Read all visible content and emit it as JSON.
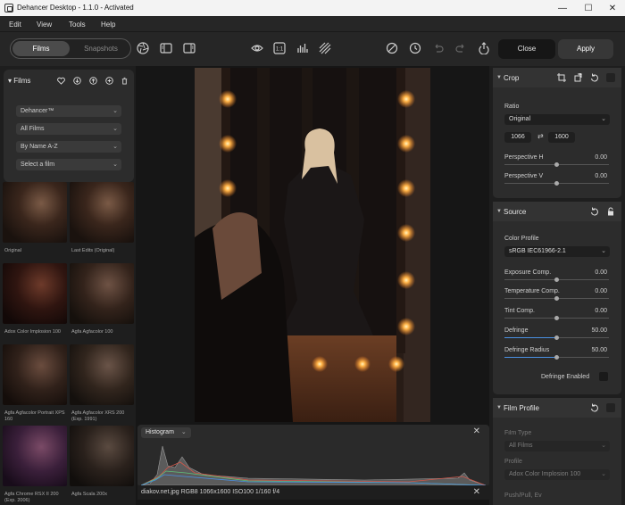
{
  "window": {
    "title": "Dehancer Desktop - 1.1.0 - Activated"
  },
  "menu": [
    "Edit",
    "View",
    "Tools",
    "Help"
  ],
  "toolbar": {
    "tab_films": "Films",
    "tab_snapshots": "Snapshots",
    "close_label": "Close",
    "apply_label": "Apply"
  },
  "films_panel": {
    "title": "Films",
    "selects": [
      "Dehancer™",
      "All Films",
      "By Name A-Z",
      "Select a film"
    ],
    "thumbnails": [
      "Original",
      "Last Edits (Original)",
      "Adox Color Implosion 100",
      "Agfa Agfacolor 100",
      "Agfa Agfacolor Portrait XPS 160",
      "Agfa Agfacolor XRS 200 (Exp. 1991)",
      "Agfa Chrome RSX II 200 (Exp. 2006)",
      "Agfa Scala 200x"
    ]
  },
  "histogram": {
    "title": "Histogram"
  },
  "info_bar": {
    "text": "diakov.net.jpg  RGB8  1066x1600  ISO100  1/160  f/4"
  },
  "crop": {
    "title": "Crop",
    "ratio_label": "Ratio",
    "ratio_value": "Original",
    "width": "1066",
    "height": "1600",
    "perspective_h_label": "Perspective H",
    "perspective_h_value": "0.00",
    "perspective_v_label": "Perspective V",
    "perspective_v_value": "0.00"
  },
  "source": {
    "title": "Source",
    "color_profile_label": "Color Profile",
    "color_profile_value": "sRGB IEC61966-2.1",
    "exposure_label": "Exposure Comp.",
    "exposure_value": "0.00",
    "temperature_label": "Temperature Comp.",
    "temperature_value": "0.00",
    "tint_label": "Tint Comp.",
    "tint_value": "0.00",
    "defringe_label": "Defringe",
    "defringe_value": "50.00",
    "defringe_radius_label": "Defringe Radius",
    "defringe_radius_value": "50.00",
    "defringe_enabled_label": "Defringe Enabled"
  },
  "film_profile": {
    "title": "Film Profile",
    "film_type_label": "Film Type",
    "film_type_value": "All Films",
    "profile_label": "Profile",
    "profile_value": "Adox Color Implosion 100",
    "push_pull_label": "Push/Pull, Ev"
  },
  "colors": {
    "accent": "#4a90e2",
    "panel": "#2c2c2c",
    "background": "#161616"
  }
}
